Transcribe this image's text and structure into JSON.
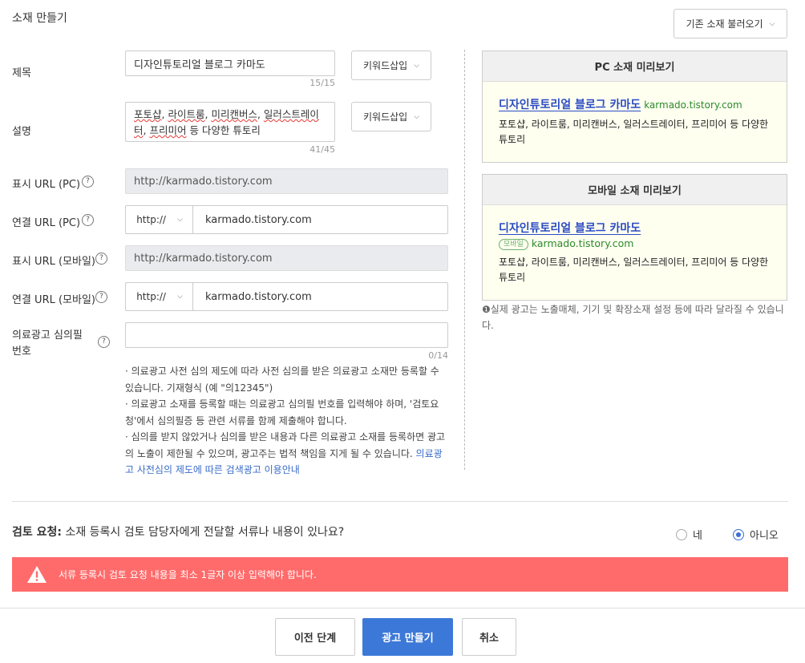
{
  "page_title": "소재 만들기",
  "load_button": "기존 소재 불러오기",
  "keyword_button": "키워드삽입",
  "form": {
    "title": {
      "label": "제목",
      "value": "디자인튜토리얼 블로그 카마도",
      "counter": "15/15"
    },
    "description": {
      "label": "설명",
      "value_parts": [
        "포토샵",
        ", ",
        "라이트룸",
        ", ",
        "미리캔버스",
        ", ",
        "일러스트레이터",
        ", ",
        "프리미어",
        " 등 다양한 튜토리"
      ],
      "counter": "41/45"
    },
    "display_url_pc": {
      "label": "표시 URL (PC)",
      "value": "http://karmado.tistory.com"
    },
    "link_url_pc": {
      "label": "연결 URL (PC)",
      "protocol": "http://",
      "value": "karmado.tistory.com"
    },
    "display_url_mobile": {
      "label": "표시 URL (모바일)",
      "value": "http://karmado.tistory.com"
    },
    "link_url_mobile": {
      "label": "연결 URL (모바일)",
      "protocol": "http://",
      "value": "karmado.tistory.com"
    },
    "medical": {
      "label_line1": "의료광고 심의필",
      "label_line2": "번호",
      "value": "",
      "counter": "0/14"
    }
  },
  "notes": {
    "n1": "의료광고 사전 심의 제도에 따라 사전 심의를 받은 의료광고 소재만 등록할 수 있습니다. 기재형식 (예 \"의12345\")",
    "n2": "의료광고 소재를 등록할 때는 의료광고 심의필 번호를 입력해야 하며, '검토요청'에서 심의필증 등 관련 서류를 함께 제출해야 합니다.",
    "n3": "심의를 받지 않았거나 심의를 받은 내용과 다른 의료광고 소재를 등록하면 광고의 노출이 제한될 수 있으며, 광고주는 법적 책임을 지게 될 수 있습니다.",
    "link": "의료광고 사전심의 제도에 따른 검색광고 이용안내"
  },
  "preview_pc": {
    "header": "PC 소재 미리보기",
    "title": "디자인튜토리얼 블로그 카마도",
    "url": "karmado.tistory.com",
    "desc": "포토샵, 라이트룸, 미리캔버스, 일러스트레이터, 프리미어 등 다양한 튜토리"
  },
  "preview_mobile": {
    "header": "모바일 소재 미리보기",
    "title": "디자인튜토리얼 블로그 카마도",
    "badge": "모바일",
    "url": "karmado.tistory.com",
    "desc": "포토샵, 라이트룸, 미리캔버스, 일러스트레이터, 프리미어 등 다양한 튜토리"
  },
  "preview_info": "❶실제 광고는 노출매체, 기기 및 확장소재 설정 등에 따라 달라질 수 있습니다.",
  "review": {
    "bold": "검토 요청:",
    "question": " 소재 등록시 검토 담당자에게 전달할 서류나 내용이 있나요?",
    "option_yes": "네",
    "option_no": "아니오",
    "selected": "아니오"
  },
  "alert_message": "서류 등록시 검토 요청 내용을 최소 1글자 이상 입력해야 합니다.",
  "footer": {
    "prev": "이전 단계",
    "create": "광고 만들기",
    "cancel": "취소"
  },
  "colors": {
    "accent": "#3c78d8",
    "alert": "#ff6b6b",
    "preview_bg": "#fffff0",
    "link": "#2a4bc4",
    "url": "#2c8a2c"
  }
}
